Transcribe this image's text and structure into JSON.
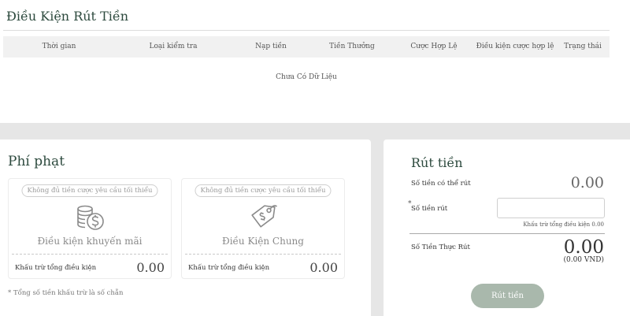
{
  "conditions": {
    "title": "Điều Kiện Rút Tiền",
    "columns": [
      "Thời gian",
      "Loại kiểm tra",
      "Nạp tiền",
      "Tiền Thưởng",
      "Cược Hợp Lệ",
      "Điều kiện cược hợp lệ",
      "Trạng thái"
    ],
    "empty_text": "Chưa Có Dữ Liệu"
  },
  "penalty": {
    "title": "Phí phạt",
    "cards": [
      {
        "pill": "Không đủ tiền cược yêu cầu tối thiểu",
        "name": "Điều kiện khuyến mãi",
        "icon": "coins-dollar-icon",
        "deduct_label": "Khấu trừ tổng điều kiện",
        "deduct_value": "0.00"
      },
      {
        "pill": "Không đủ tiền cược yêu cầu tối thiểu",
        "name": "Điều Kiện Chung",
        "icon": "price-tag-icon",
        "deduct_label": "Khấu trừ tổng điều kiện",
        "deduct_value": "0.00"
      }
    ],
    "note": "* Tổng số tiền khấu trừ là số chẵn"
  },
  "withdraw": {
    "title": "Rút tiền",
    "available_label": "Số tiền có thể rút",
    "available_value": "0.00",
    "amount_label": "Số tiền rút",
    "amount_required_mark": "*",
    "amount_value": "",
    "deduct_hint": "Khấu trừ tổng điều kiện 0.00",
    "actual_label": "Số Tiền Thực Rút",
    "actual_value": "0.00",
    "actual_vnd": "(0.00 VND)",
    "button_label": "Rút tiền"
  },
  "colors": {
    "heading": "#2d4a3e",
    "button": "#a9b8ac",
    "background": "#e6e6e6"
  }
}
